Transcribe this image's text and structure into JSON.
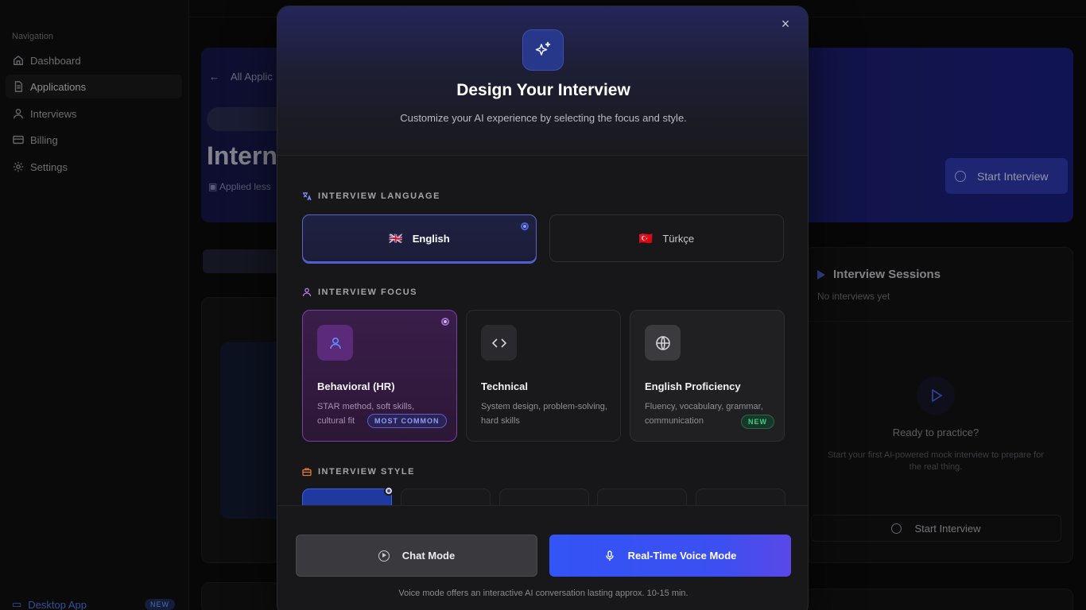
{
  "sidebar": {
    "heading": "Navigation",
    "items": [
      {
        "label": "Dashboard",
        "icon": "home-icon"
      },
      {
        "label": "Applications",
        "icon": "document-icon"
      },
      {
        "label": "Interviews",
        "icon": "user-icon"
      },
      {
        "label": "Billing",
        "icon": "card-icon"
      },
      {
        "label": "Settings",
        "icon": "gear-icon"
      }
    ],
    "desktop_app": "Desktop App",
    "desktop_badge": "NEW"
  },
  "background": {
    "back_link": "All Applic",
    "page_title": "Intern",
    "applied": "Applied less",
    "start_button": "Start Interview",
    "sessions": {
      "title": "Interview Sessions",
      "empty": "No interviews yet",
      "ready_title": "Ready to practice?",
      "ready_sub": "Start your first AI-powered mock interview to prepare for the real thing.",
      "start_button": "Start Interview"
    }
  },
  "modal": {
    "title": "Design Your Interview",
    "subtitle": "Customize your AI experience by selecting the focus and style.",
    "close": "×",
    "language": {
      "label": "INTERVIEW LANGUAGE",
      "options": [
        {
          "flag": "🇬🇧",
          "label": "English",
          "selected": true
        },
        {
          "flag": "🇹🇷",
          "label": "Türkçe",
          "selected": false
        }
      ]
    },
    "focus": {
      "label": "INTERVIEW FOCUS",
      "options": [
        {
          "title": "Behavioral (HR)",
          "desc": "STAR method, soft skills, cultural fit",
          "badge": "MOST COMMON",
          "icon": "user-icon",
          "selected": true
        },
        {
          "title": "Technical",
          "desc": "System design, problem-solving, hard skills",
          "icon": "code-icon",
          "selected": false
        },
        {
          "title": "English Proficiency",
          "desc": "Fluency, vocabulary, grammar, communication",
          "badge": "NEW",
          "icon": "globe-icon",
          "selected": false
        }
      ]
    },
    "style": {
      "label": "INTERVIEW STYLE"
    },
    "buttons": {
      "chat": "Chat Mode",
      "voice": "Real-Time Voice Mode"
    },
    "footer_note": "Voice mode offers an interactive AI conversation lasting approx. 10-15 min."
  },
  "colors": {
    "accent": "#3354f6",
    "selected_focus": "#7b3fa8",
    "new_badge": "#3fcf7d"
  }
}
